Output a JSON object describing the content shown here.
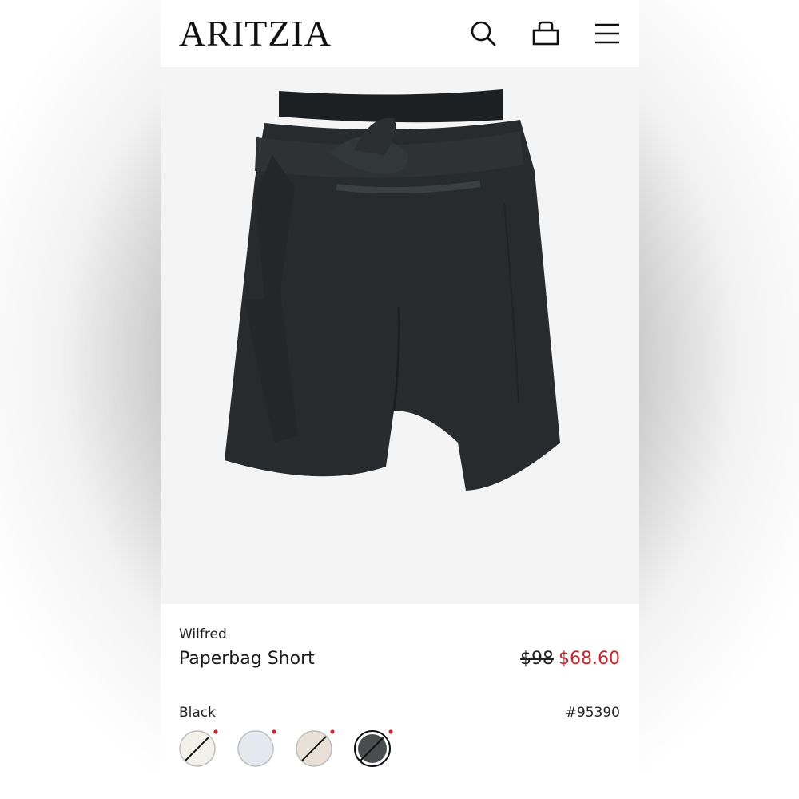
{
  "header": {
    "logo": "ARITZIA",
    "icons": [
      "search-icon",
      "bag-icon",
      "menu-icon"
    ]
  },
  "product": {
    "brand": "Wilfred",
    "name": "Paperbag Short",
    "original_price": "$98",
    "sale_price": "$68.60",
    "color_label": "Black",
    "sku": "#95390",
    "image": "black paperbag shorts with tie belt"
  },
  "swatches": [
    {
      "name": "ivory",
      "color": "#f1f0ea",
      "unavailable": true
    },
    {
      "name": "light-blue",
      "color": "#e3e9ee",
      "unavailable": false
    },
    {
      "name": "beige",
      "color": "#e8e0d6",
      "unavailable": true
    },
    {
      "name": "black",
      "color": "#4a4d4e",
      "unavailable": true,
      "selected": true
    }
  ],
  "colors": {
    "sale": "#c8262b",
    "text": "#1a1a1a",
    "swatch_dot": "#c8262b"
  }
}
